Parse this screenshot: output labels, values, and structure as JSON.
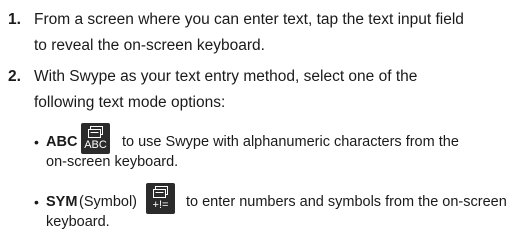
{
  "steps": [
    {
      "number": "1.",
      "lines": [
        "From a screen where you can enter text, tap the text input field",
        "to reveal the on-screen keyboard."
      ]
    },
    {
      "number": "2.",
      "lines": [
        "With Swype as your text entry method, select one of the",
        "following text mode options:"
      ]
    }
  ],
  "options": [
    {
      "bullet": "•",
      "keyword": "ABC",
      "key_label": "ABC",
      "key_icon": "keyboard-icon",
      "line1_rest": "to use Swype with alphanumeric characters from the",
      "line2": "on-screen keyboard."
    },
    {
      "bullet": "•",
      "keyword": "SYM",
      "keyword_note": "(Symbol)",
      "key_label": "+!=",
      "key_icon": "keyboard-icon",
      "line1_rest": "to enter numbers and symbols from the on-screen",
      "line2": "keyboard."
    }
  ],
  "colors": {
    "text": "#1a1a1a",
    "key_background": "#2b2b2b",
    "key_foreground": "#ffffff"
  }
}
